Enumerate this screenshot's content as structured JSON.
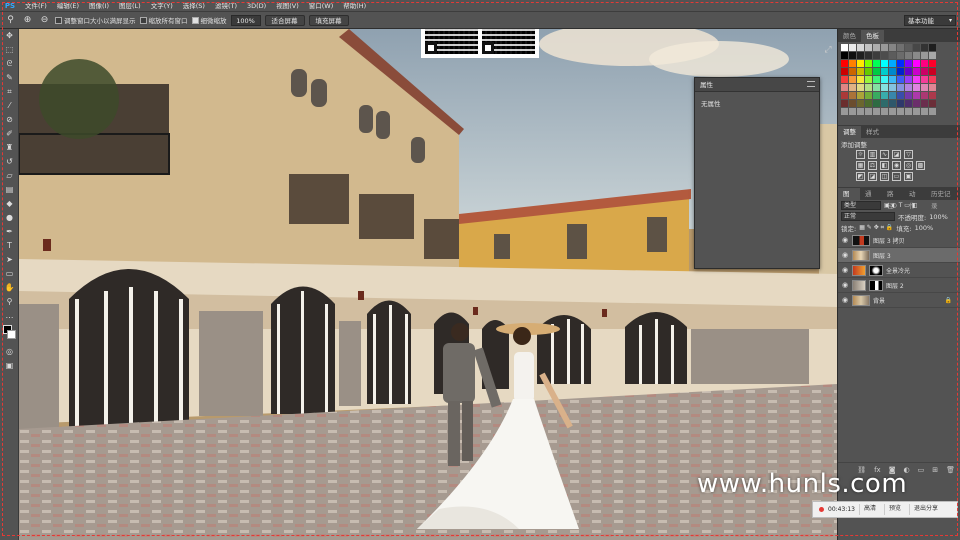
{
  "app": {
    "logo": "PS"
  },
  "menu": [
    "文件(F)",
    "编辑(E)",
    "图像(I)",
    "图层(L)",
    "文字(Y)",
    "选择(S)",
    "滤镜(T)",
    "3D(D)",
    "视图(V)",
    "窗口(W)",
    "帮助(H)"
  ],
  "options": {
    "resize_windows": "调整窗口大小以满屏显示",
    "zoom_all": "缩放所有窗口",
    "scrubby_zoom": "细微缩放",
    "zoom_value": "100%",
    "fit_screen": "适合屏幕",
    "fill_screen": "填充屏幕",
    "workspace": "基本功能"
  },
  "properties": {
    "title": "属性",
    "body": "无属性"
  },
  "panels": {
    "color_tabs": [
      "颜色",
      "色板"
    ],
    "adjust_tabs": [
      "调整",
      "样式"
    ],
    "adjust_add": "添加调整",
    "layer_tabs": [
      "图层",
      "通道",
      "路径",
      "动作",
      "历史记录"
    ],
    "filter_kind": "类型",
    "blend_mode": "正常",
    "opacity_label": "不透明度:",
    "opacity_value": "100%",
    "lock_label": "锁定:",
    "fill_label": "填充:",
    "fill_value": "100%"
  },
  "layers": [
    {
      "name": "图层 3 拷贝",
      "selected": false
    },
    {
      "name": "图层 3",
      "selected": true
    },
    {
      "name": "全景冷光",
      "selected": false
    },
    {
      "name": "图层 2",
      "selected": false
    },
    {
      "name": "背景",
      "selected": false
    }
  ],
  "watermark": "www.hunls.com",
  "recording": {
    "timer": "00:43:13",
    "quality": "高清",
    "preview": "预览",
    "exit_share": "退出分享"
  },
  "colors": {
    "ui_bg": "#535353",
    "panel_dark": "#3c3c3c",
    "record_red": "#e53935",
    "ps_blue": "#31a8ff"
  }
}
